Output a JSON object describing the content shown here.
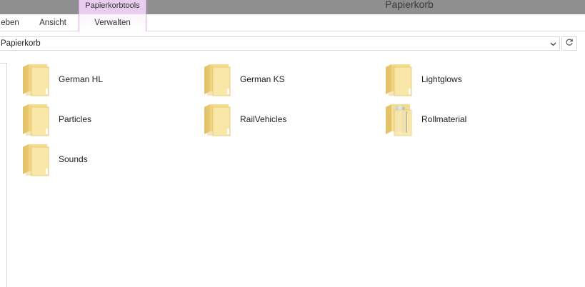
{
  "window": {
    "title": "Papierkorb",
    "context_group": "Papierkorbtools"
  },
  "ribbon": {
    "tabs": [
      {
        "label": "eben"
      },
      {
        "label": "Ansicht"
      },
      {
        "label": "Verwalten"
      }
    ]
  },
  "address": {
    "path": "Papierkorb"
  },
  "icons": {
    "folder": "folder-icon",
    "folder_open": "folder-open-icon",
    "refresh": "refresh-icon",
    "dropdown": "chevron-down-icon"
  },
  "items": [
    {
      "name": "German HL",
      "type": "folder"
    },
    {
      "name": "German KS",
      "type": "folder"
    },
    {
      "name": "Lightglows",
      "type": "folder"
    },
    {
      "name": "Particles",
      "type": "folder"
    },
    {
      "name": "RailVehicles",
      "type": "folder"
    },
    {
      "name": "Rollmaterial",
      "type": "folder-with-files"
    },
    {
      "name": "Sounds",
      "type": "folder"
    }
  ]
}
